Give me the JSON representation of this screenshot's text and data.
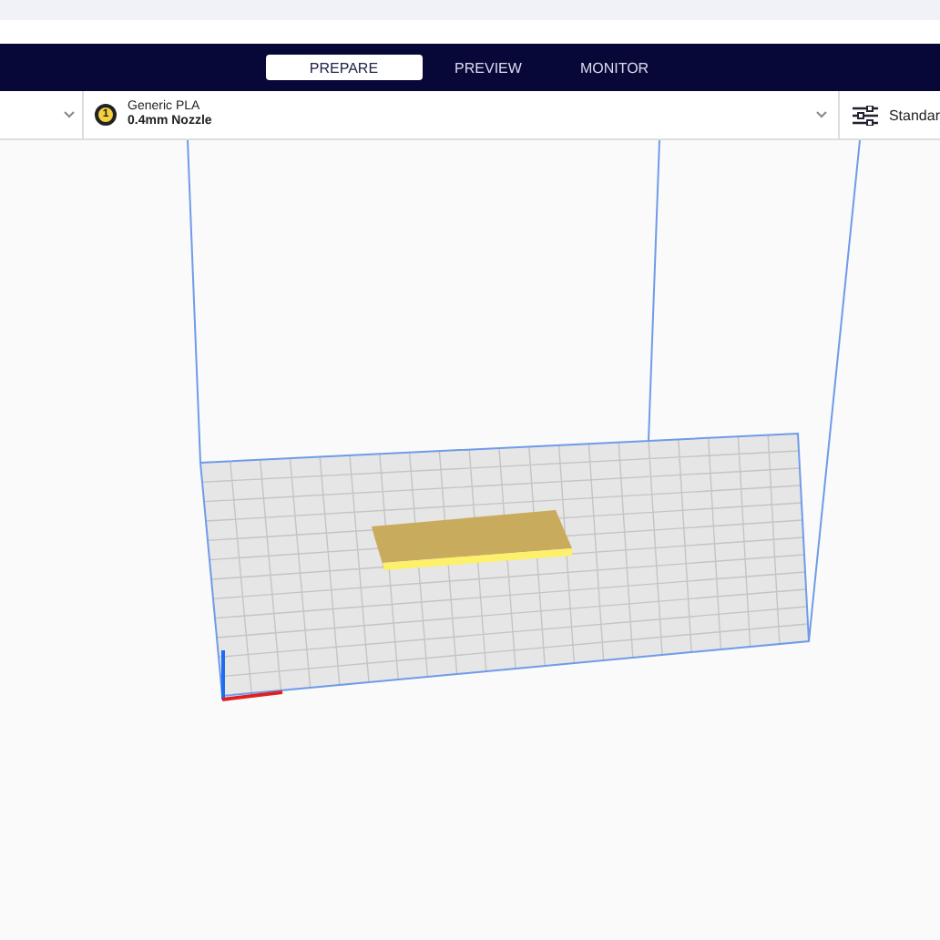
{
  "tabs": [
    {
      "label": "PREPARE",
      "selected": true
    },
    {
      "label": "PREVIEW",
      "selected": false
    },
    {
      "label": "MONITOR",
      "selected": false
    }
  ],
  "toolbar": {
    "extruder": {
      "number": "1",
      "material": "Generic PLA",
      "nozzle": "0.4mm Nozzle"
    },
    "profile": "Standar"
  }
}
